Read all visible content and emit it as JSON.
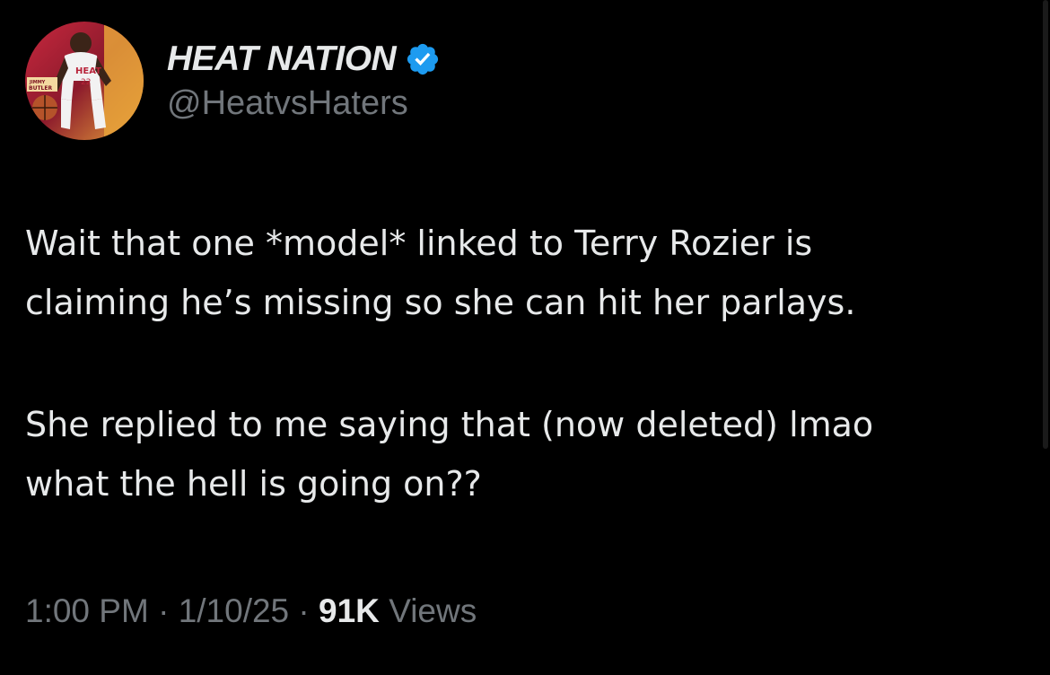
{
  "tweet": {
    "author": {
      "display_name": "HEAT NATION",
      "handle": "@HeatvsHaters",
      "verified": true,
      "avatar_text": "JIMMY BUTLER",
      "avatar_jersey": "HEAT 22"
    },
    "text": {
      "paragraph_1": "Wait that one *model* linked to Terry Rozier is\nclaiming he’s missing so she can hit her parlays.",
      "paragraph_2": "She replied to me saying that (now deleted) lmao\nwhat the hell is going on??"
    },
    "meta": {
      "time": "1:00 PM",
      "separator": "·",
      "date": "1/10/25",
      "views_count": "91K",
      "views_label": "Views"
    }
  },
  "colors": {
    "background": "#000000",
    "text_primary": "#e7e9ea",
    "text_secondary": "#71767b",
    "verified_badge": "#1d9bf0",
    "avatar_red": "#b8243a",
    "avatar_gold": "#e8a33a"
  },
  "icons": {
    "verified": "verified-badge-icon"
  }
}
